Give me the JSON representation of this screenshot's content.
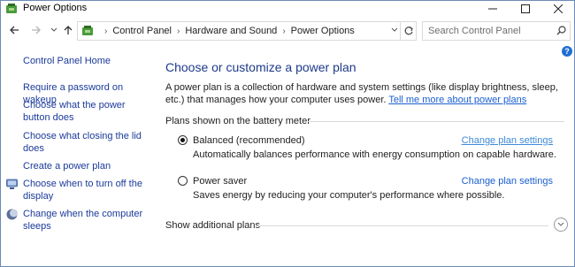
{
  "window": {
    "title": "Power Options"
  },
  "address": {
    "crumbs": [
      "Control Panel",
      "Hardware and Sound",
      "Power Options"
    ]
  },
  "search": {
    "placeholder": "Search Control Panel"
  },
  "sidebar": {
    "home": "Control Panel Home",
    "items": [
      "Require a password on wakeup",
      "Choose what the power button does",
      "Choose what closing the lid does",
      "Create a power plan",
      "Choose when to turn off the display",
      "Change when the computer sleeps"
    ]
  },
  "main": {
    "title": "Choose or customize a power plan",
    "intro": "A power plan is a collection of hardware and system settings (like display brightness, sleep, etc.) that manages how your computer uses power.",
    "intro_link": "Tell me more about power plans",
    "section_label": "Plans shown on the battery meter",
    "plans": [
      {
        "name": "Balanced (recommended)",
        "description": "Automatically balances performance with energy consumption on capable hardware.",
        "link": "Change plan settings",
        "selected": true
      },
      {
        "name": "Power saver",
        "description": "Saves energy by reducing your computer's performance where possible.",
        "link": "Change plan settings",
        "selected": false
      }
    ],
    "show_additional": "Show additional plans"
  },
  "colors": {
    "link": "#1a3a9a",
    "title": "#1e3a8a",
    "accent_link": "#1a5fd1"
  }
}
